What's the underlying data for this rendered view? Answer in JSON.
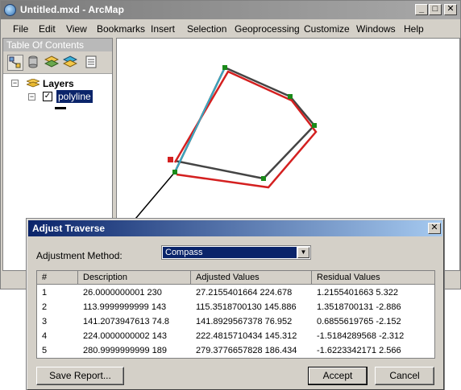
{
  "window": {
    "title": "Untitled.mxd - ArcMap",
    "min": "_",
    "max": "□",
    "close": "✕"
  },
  "menu": [
    "File",
    "Edit",
    "View",
    "Bookmarks",
    "Insert",
    "Selection",
    "Geoprocessing",
    "Customize",
    "Windows",
    "Help"
  ],
  "toc": {
    "title": "Table Of Contents",
    "root_label": "Layers",
    "layer_name": "polyline",
    "expander": "⊟",
    "checkbox_checked": true
  },
  "dialog": {
    "title": "Adjust Traverse",
    "close": "✕",
    "method_label": "Adjustment Method:",
    "method_value": "Compass",
    "columns": [
      "#",
      "Description",
      "Adjusted Values",
      "Residual Values"
    ],
    "rows": [
      {
        "num": "1",
        "desc": "26.0000000001  230",
        "adjusted": "27.2155401664  224.678",
        "residual": "1.2155401663  5.322"
      },
      {
        "num": "2",
        "desc": "113.9999999999  143",
        "adjusted": "115.3518700130  145.886",
        "residual": "1.3518700131  -2.886"
      },
      {
        "num": "3",
        "desc": "141.2073947613  74.8",
        "adjusted": "141.8929567378  76.952",
        "residual": "0.6855619765  -2.152"
      },
      {
        "num": "4",
        "desc": "224.0000000002  143",
        "adjusted": "222.4815710434  145.312",
        "residual": "-1.5184289568  -2.312"
      },
      {
        "num": "5",
        "desc": "280.9999999999  189",
        "adjusted": "279.3776657828  186.434",
        "residual": "-1.6223342171  2.566"
      }
    ],
    "save_report": "Save Report...",
    "accept": "Accept",
    "cancel": "Cancel"
  },
  "colors": {
    "original_line": "#444444",
    "adjusted_line": "#d42020",
    "highlight_line": "#37a9c6",
    "vertex": "#1a8a1a",
    "title_active": "#0a246a"
  }
}
